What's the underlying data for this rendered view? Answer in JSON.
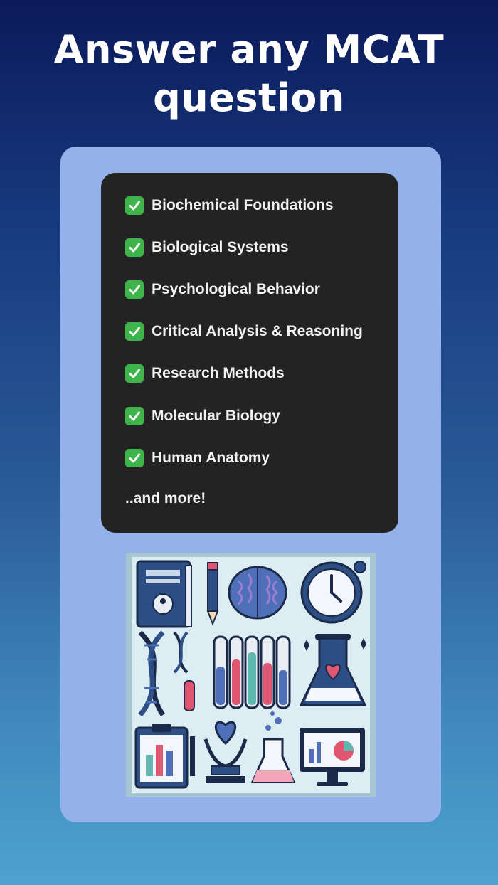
{
  "headline": {
    "line1": "Answer any MCAT",
    "line2": "question"
  },
  "topics": [
    {
      "label": "Biochemical Foundations",
      "icon": "check-mark-icon"
    },
    {
      "label": "Biological Systems",
      "icon": "check-mark-icon"
    },
    {
      "label": "Psychological Behavior",
      "icon": "check-mark-icon"
    },
    {
      "label": "Critical Analysis & Reasoning",
      "icon": "check-mark-icon"
    },
    {
      "label": "Research Methods",
      "icon": "check-mark-icon"
    },
    {
      "label": "Molecular Biology",
      "icon": "check-mark-icon"
    },
    {
      "label": "Human Anatomy",
      "icon": "check-mark-icon"
    }
  ],
  "more_label": "..and more!",
  "colors": {
    "background_top": "#0b1a5a",
    "background_bottom": "#4ea3cf",
    "card": "#93b2ec",
    "panel": "#232323",
    "check": "#3fb44a"
  },
  "illustration": {
    "icons": [
      "book-icon",
      "pencil-icon",
      "brain-icon",
      "clock-icon",
      "dna-icon",
      "test-tubes-icon",
      "flask-heart-icon",
      "clipboard-chart-icon",
      "heart-hands-icon",
      "beaker-icon",
      "monitor-chart-icon"
    ]
  }
}
